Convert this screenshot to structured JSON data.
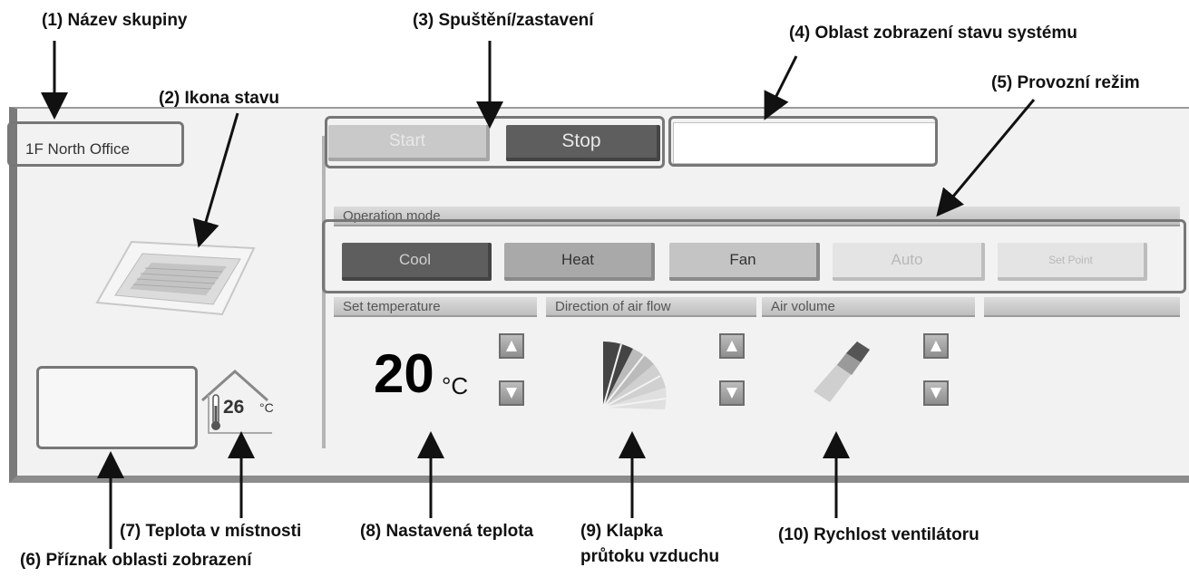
{
  "callouts": {
    "c1": "(1) Název skupiny",
    "c2": "(2) Ikona stavu",
    "c3": "(3) Spuštění/zastavení",
    "c4": "(4) Oblast zobrazení stavu systému",
    "c5": "(5) Provozní režim",
    "c6": "(6) Příznak oblasti zobrazení",
    "c7": "(7) Teplota v místnosti",
    "c8": "(8) Nastavená teplota",
    "c9_line1": "(9) Klapka",
    "c9_line2": "průtoku vzduchu",
    "c10": "(10) Rychlost ventilátoru"
  },
  "panel": {
    "group_name": "1F North Office",
    "start_label": "Start",
    "stop_label": "Stop",
    "operation_mode_label": "Operation mode",
    "modes": [
      "Cool",
      "Heat",
      "Fan",
      "Auto",
      "Set Point"
    ],
    "selected_mode": "Cool",
    "set_temperature_label": "Set temperature",
    "direction_label": "Direction of air flow",
    "air_volume_label": "Air volume",
    "set_temperature_value": "20",
    "set_temperature_unit": "°C",
    "room_temperature_value": "26",
    "room_temperature_unit": "°C"
  },
  "colors": {
    "selected_button": "#5e5e5e",
    "panel_bg": "#f2f2f2",
    "highlight_box": "#777777"
  }
}
